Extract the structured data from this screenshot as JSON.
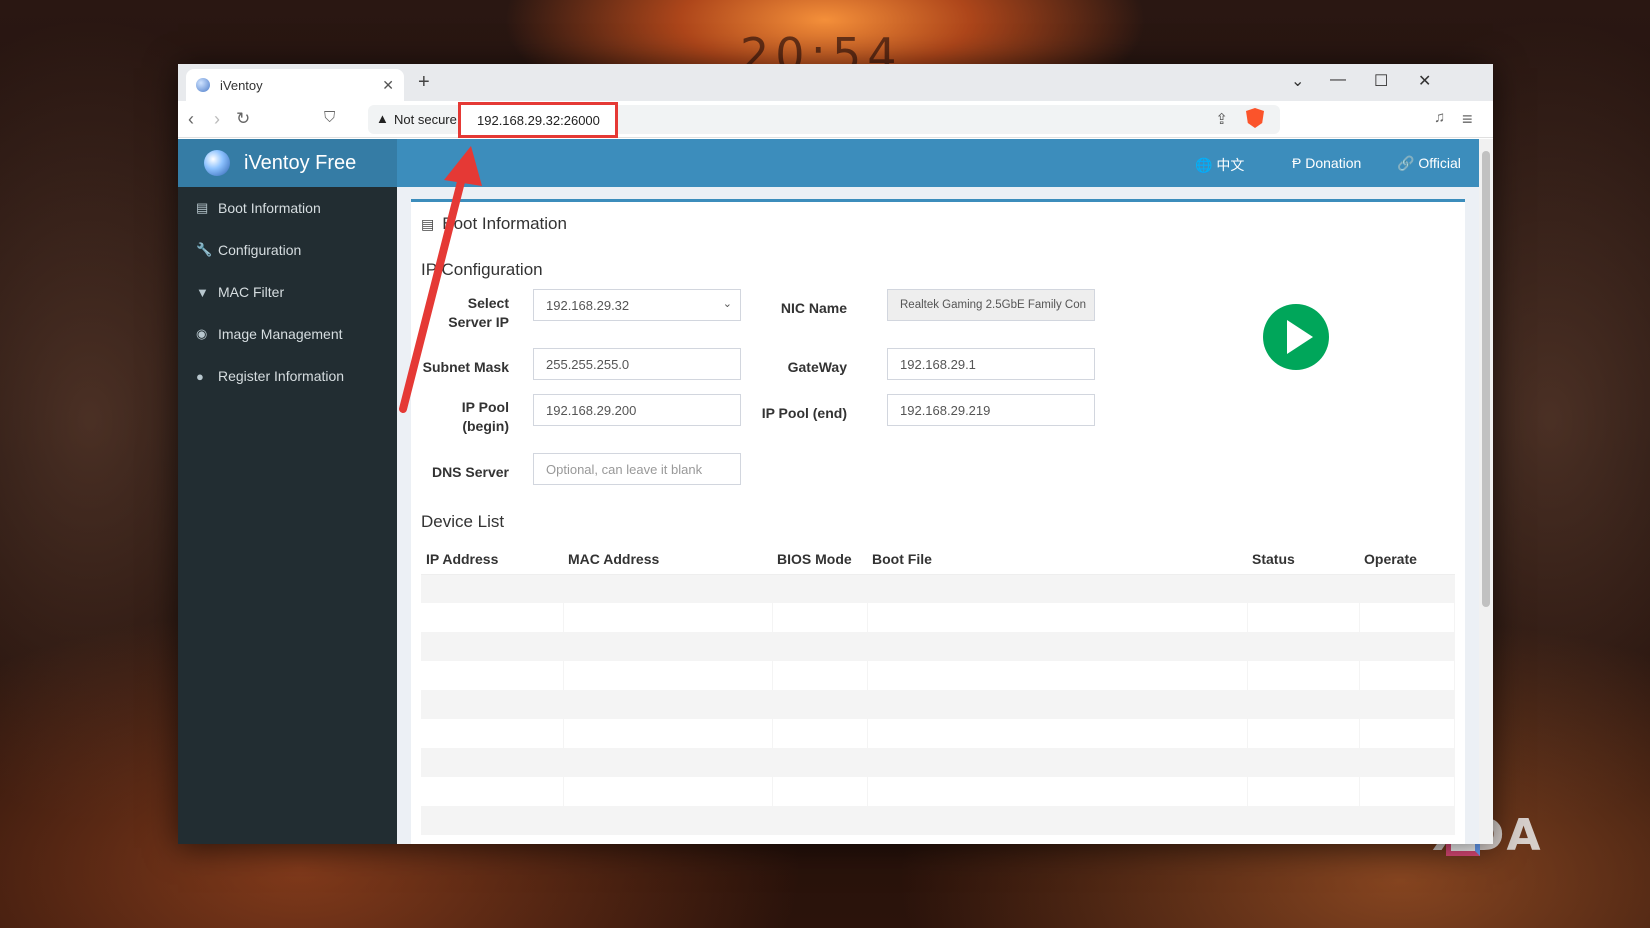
{
  "background": {
    "clock": "20:54",
    "watermark": "XDA"
  },
  "browser": {
    "tab_title": "iVentoy",
    "new_tab": "+",
    "security_label": "Not secure",
    "url": "192.168.29.32:26000"
  },
  "app": {
    "brand": "iVentoy Free",
    "sidebar": [
      {
        "label": "Boot Information",
        "icon": "server-icon"
      },
      {
        "label": "Configuration",
        "icon": "wrench-icon"
      },
      {
        "label": "MAC Filter",
        "icon": "filter-icon"
      },
      {
        "label": "Image Management",
        "icon": "globe-icon"
      },
      {
        "label": "Register Information",
        "icon": "user-icon"
      }
    ],
    "topnav": {
      "language": "中文",
      "donation": "Donation",
      "official": "Official"
    },
    "page_title": "Boot Information",
    "ip_config": {
      "title": "IP Configuration",
      "select_server_ip_label": "Select Server IP",
      "select_server_ip_value": "192.168.29.32",
      "nic_name_label": "NIC Name",
      "nic_name_value": "Realtek Gaming 2.5GbE Family Con",
      "subnet_mask_label": "Subnet Mask",
      "subnet_mask_value": "255.255.255.0",
      "gateway_label": "GateWay",
      "gateway_value": "192.168.29.1",
      "ip_pool_begin_label": "IP Pool (begin)",
      "ip_pool_begin_value": "192.168.29.200",
      "ip_pool_end_label": "IP Pool (end)",
      "ip_pool_end_value": "192.168.29.219",
      "dns_server_label": "DNS Server",
      "dns_server_placeholder": "Optional, can leave it blank"
    },
    "device_list": {
      "title": "Device List",
      "columns": [
        "IP Address",
        "MAC Address",
        "BIOS Mode",
        "Boot File",
        "Status",
        "Operate"
      ]
    }
  },
  "colors": {
    "header_blue": "#3c8dbc",
    "sidebar_dark": "#222d32",
    "start_green": "#00a65a",
    "highlight_red": "#e53935"
  }
}
